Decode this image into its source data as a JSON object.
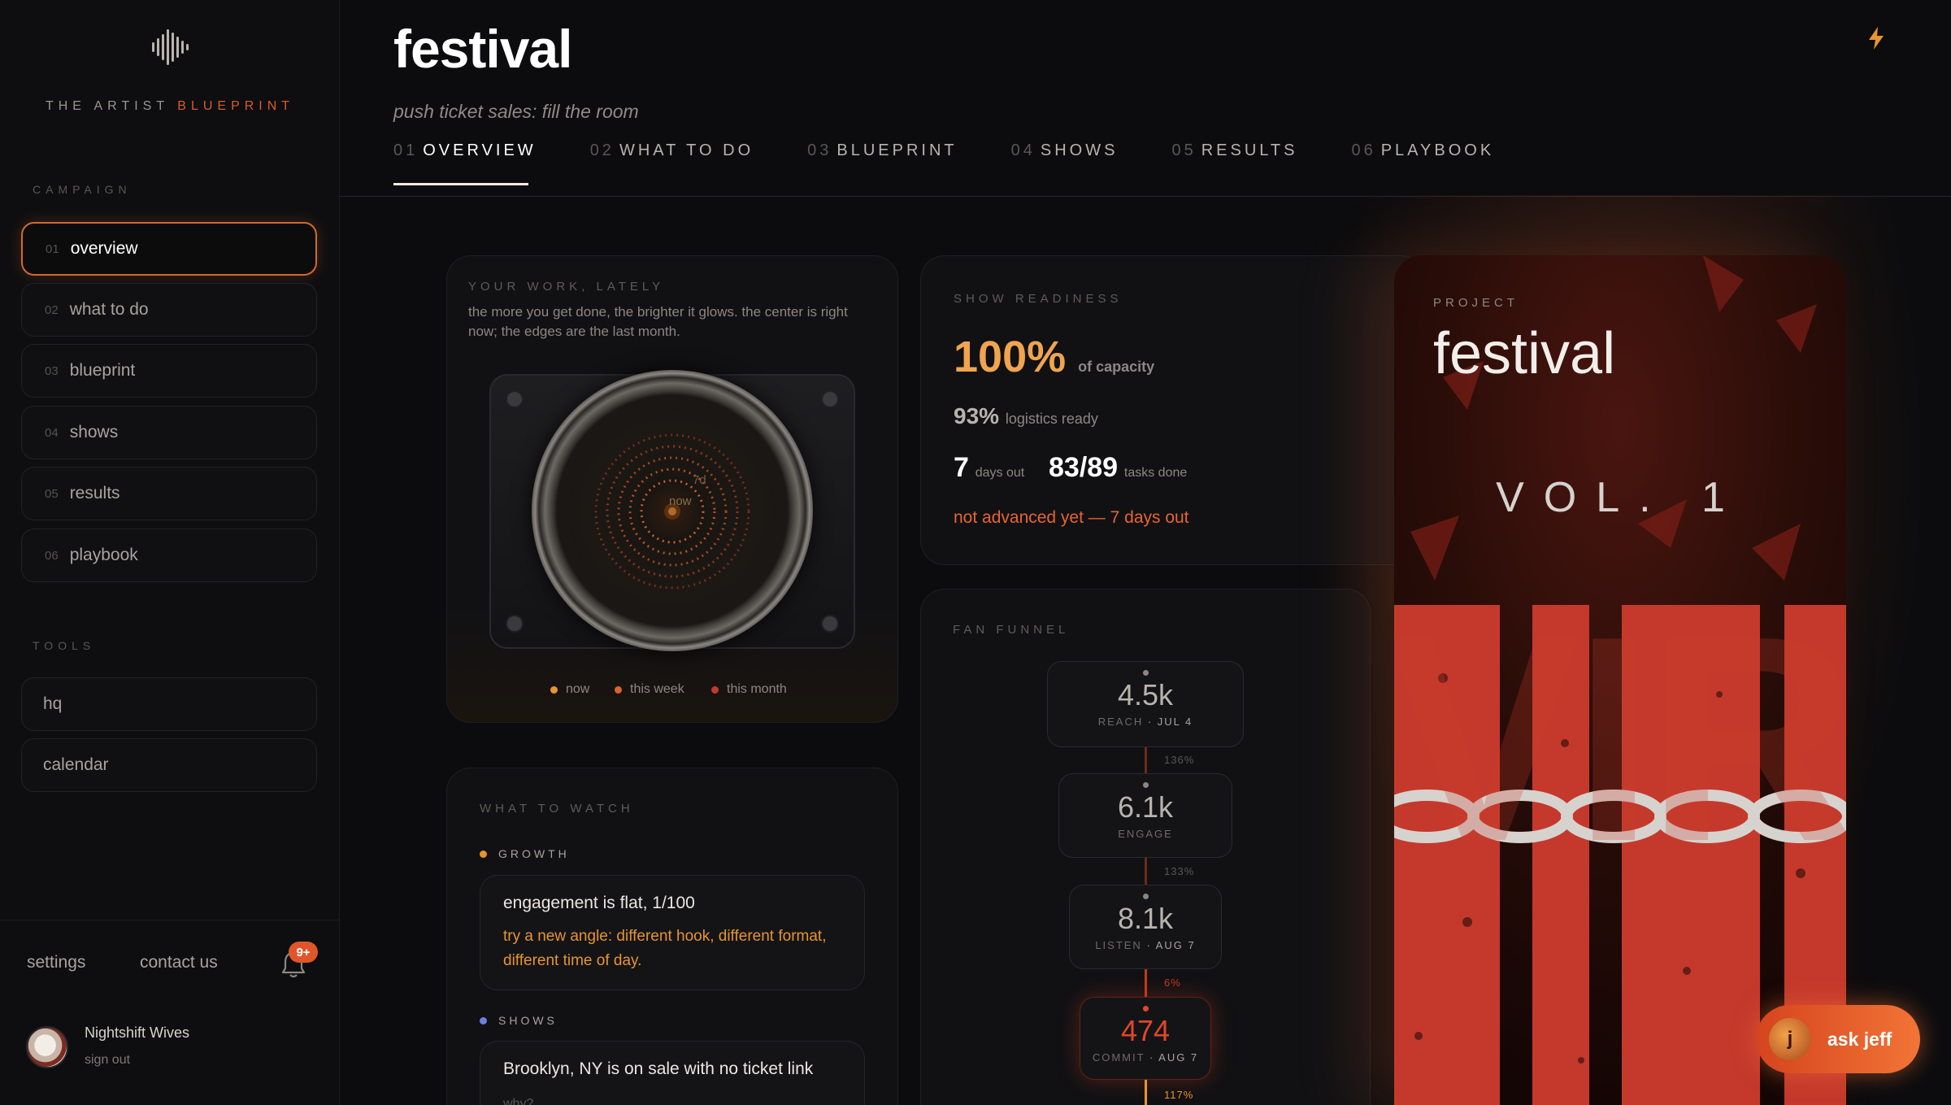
{
  "sidebar": {
    "brand_prefix": "THE ARTIST ",
    "brand_accent": "BLUEPRINT",
    "campaign_label": "CAMPAIGN",
    "items": [
      {
        "num": "01",
        "label": "overview"
      },
      {
        "num": "02",
        "label": "what to do"
      },
      {
        "num": "03",
        "label": "blueprint"
      },
      {
        "num": "04",
        "label": "shows"
      },
      {
        "num": "05",
        "label": "results"
      },
      {
        "num": "06",
        "label": "playbook"
      }
    ],
    "tools_label": "TOOLS",
    "tools": [
      {
        "label": "hq"
      },
      {
        "label": "calendar"
      }
    ],
    "settings": "settings",
    "contact": "contact us",
    "notif_badge": "9+",
    "user_name": "Nightshift Wives",
    "sign_out": "sign out"
  },
  "header": {
    "title": "festival",
    "subtitle": "push ticket sales: fill the room",
    "tabs": [
      {
        "num": "01",
        "label": "OVERVIEW"
      },
      {
        "num": "02",
        "label": "WHAT TO DO"
      },
      {
        "num": "03",
        "label": "BLUEPRINT"
      },
      {
        "num": "04",
        "label": "SHOWS"
      },
      {
        "num": "05",
        "label": "RESULTS"
      },
      {
        "num": "06",
        "label": "PLAYBOOK"
      }
    ]
  },
  "work": {
    "label": "YOUR WORK, LATELY",
    "desc": "the more you get done, the brighter it glows. the center is right now; the edges are the last month.",
    "center_label": "now",
    "ring_label": "7d",
    "legend": [
      {
        "label": "now",
        "color": "#e8942f"
      },
      {
        "label": "this week",
        "color": "#d8642f"
      },
      {
        "label": "this month",
        "color": "#c03a2a"
      }
    ]
  },
  "readiness": {
    "label": "SHOW READINESS",
    "capacity_value": "100%",
    "capacity_note": "of capacity",
    "logistics_value": "93%",
    "logistics_note": "logistics ready",
    "days_value": "7",
    "days_note": "days out",
    "tasks_value": "83/89",
    "tasks_note": "tasks done",
    "warning": "not advanced yet — 7 days out"
  },
  "funnel": {
    "label": "FAN FUNNEL",
    "stages": [
      {
        "value": "4.5k",
        "label": "REACH",
        "date": " · JUL 4"
      },
      {
        "value": "6.1k",
        "label": "ENGAGE",
        "date": ""
      },
      {
        "value": "8.1k",
        "label": "LISTEN",
        "date": " · AUG 7"
      },
      {
        "value": "474",
        "label": "COMMIT",
        "date": " · AUG 7"
      }
    ],
    "conversions": [
      "136%",
      "133%",
      "6%",
      "117%"
    ]
  },
  "watch": {
    "label": "WHAT TO WATCH",
    "groups": [
      {
        "head": "GROWTH",
        "color": "#e8942f",
        "title": "engagement is flat, 1/100",
        "tip": "try a new angle: different hook, different format, different time of day."
      },
      {
        "head": "SHOWS",
        "color": "#6f7fe0",
        "title": "Brooklyn, NY is on sale with no ticket link",
        "tip": "why?"
      }
    ]
  },
  "project": {
    "label": "PROJECT",
    "name": "festival",
    "volume": "VOL. 1",
    "art_text": "VIR"
  },
  "ask": {
    "initial": "j",
    "label": "ask jeff"
  },
  "colors": {
    "accent": "#e8642f",
    "amber": "#f0a450",
    "bg": "#0c0c0e"
  }
}
